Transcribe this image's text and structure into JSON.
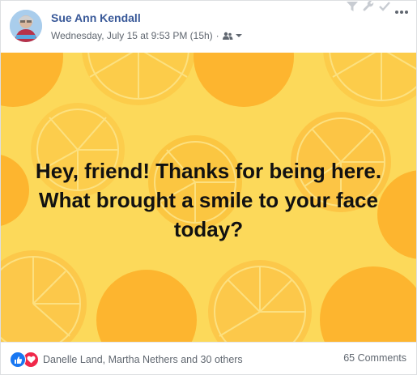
{
  "post": {
    "author_name": "Sue Ann Kendall",
    "timestamp": "Wednesday, July 15 at 9:53 PM (15h)",
    "separator": "·",
    "audience_icon": "group-audience-icon",
    "body_text": "Hey, friend! Thanks for being here. What brought a smile to your face today?",
    "background_theme": "orange-slices",
    "colors": {
      "author": "#385898",
      "meta": "#606770",
      "background_yellow": "#ffde5c",
      "orange": "#fbb93e",
      "text": "#111111"
    }
  },
  "top_tools": {
    "icons": [
      "filter-icon",
      "wrench-icon",
      "check-icon"
    ],
    "more_icon": "more-options-icon"
  },
  "footer": {
    "reactions": [
      "like-icon",
      "love-icon"
    ],
    "reaction_names": "Danelle Land, Martha Nethers and 30 others",
    "comments": "65 Comments"
  }
}
